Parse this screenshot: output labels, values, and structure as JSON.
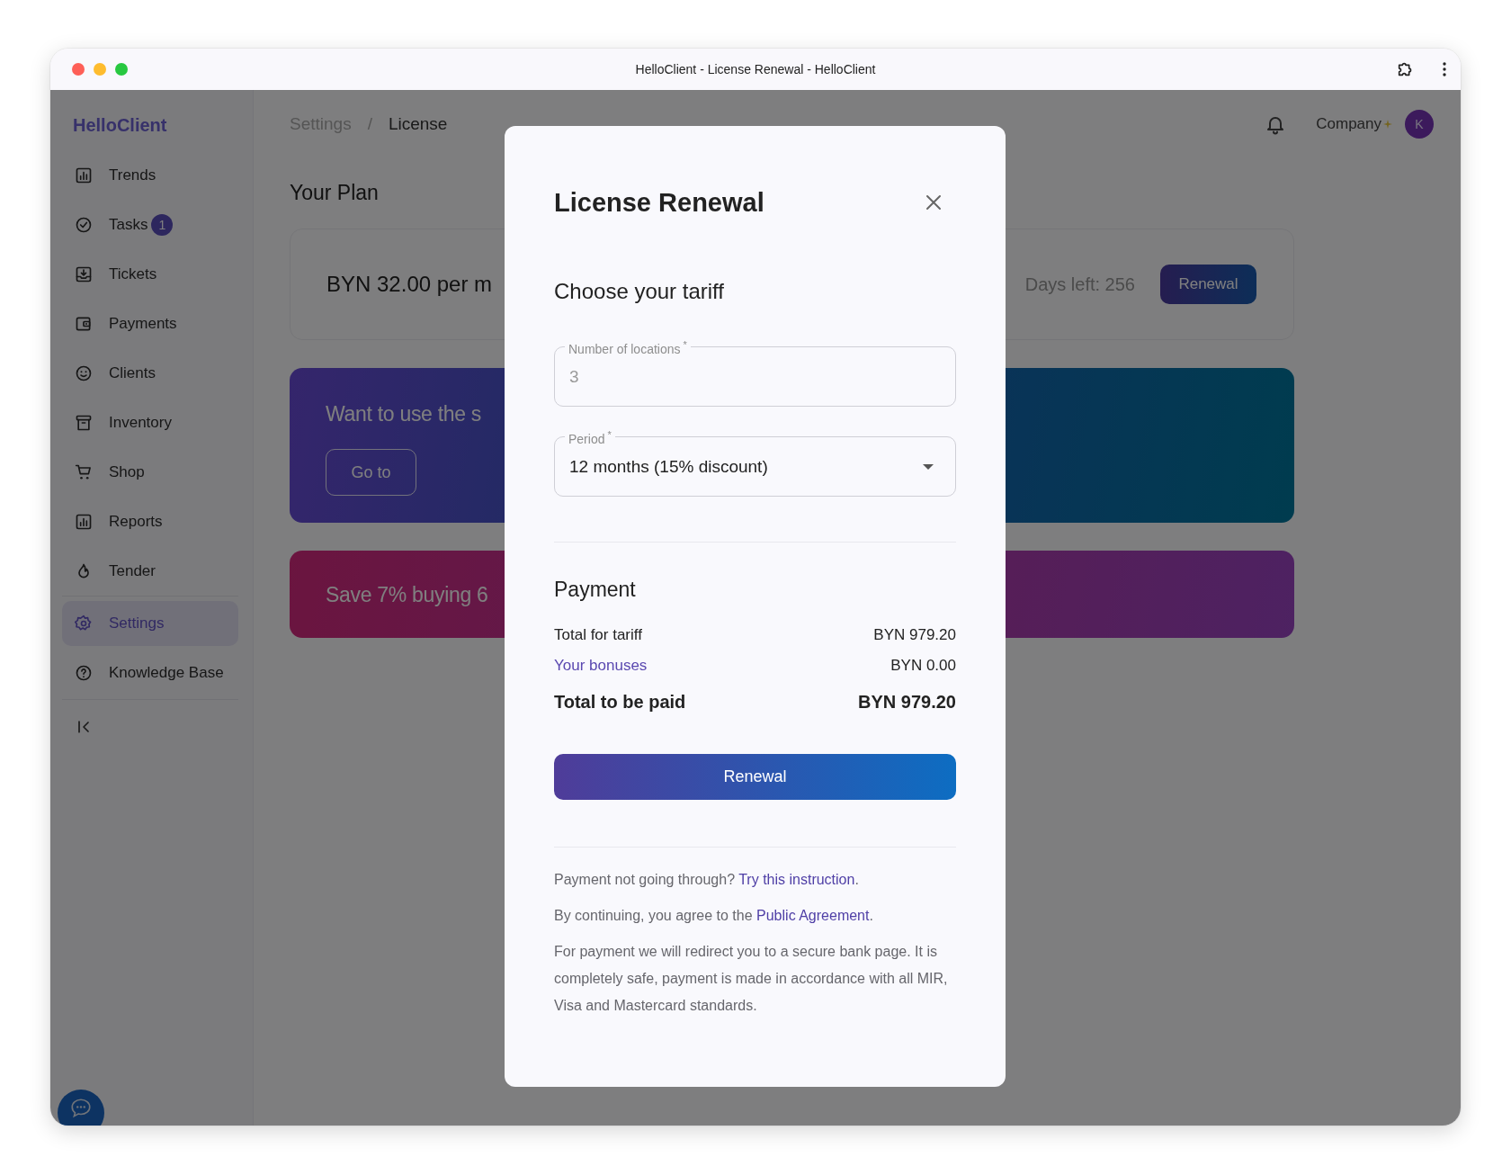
{
  "window": {
    "title": "HelloClient - License Renewal - HelloClient"
  },
  "sidebar": {
    "logo": "HelloClient",
    "items": [
      {
        "label": "Trends",
        "selected": false
      },
      {
        "label": "Tasks",
        "badge": "1",
        "selected": false
      },
      {
        "label": "Tickets",
        "selected": false
      },
      {
        "label": "Payments",
        "selected": false
      },
      {
        "label": "Clients",
        "selected": false
      },
      {
        "label": "Inventory",
        "selected": false
      },
      {
        "label": "Shop",
        "selected": false
      },
      {
        "label": "Reports",
        "selected": false
      },
      {
        "label": "Tender",
        "selected": false
      }
    ],
    "secondary_items": [
      {
        "label": "Settings",
        "selected": true
      },
      {
        "label": "Knowledge Base",
        "selected": false
      }
    ]
  },
  "header": {
    "breadcrumb": [
      "Settings",
      "License"
    ],
    "separator": "/",
    "company": "Company",
    "avatar": "K"
  },
  "plan": {
    "title": "Your Plan",
    "price": "BYN 32.00 per m",
    "days_left": "Days left: 256",
    "button": "Renewal"
  },
  "promos": [
    {
      "text": "Want to use the s",
      "button": "Go to"
    },
    {
      "text": "Save 7% buying 6"
    }
  ],
  "modal": {
    "title": "License Renewal",
    "section": "Choose your tariff",
    "fields": [
      {
        "kind": "input",
        "label": "Number of locations",
        "mark": "*",
        "placeholder": "3"
      },
      {
        "kind": "select",
        "label": "Period",
        "mark": "*",
        "value": "12 months (15% discount)"
      }
    ],
    "payment": {
      "title": "Payment",
      "rows": [
        {
          "kind": "plain",
          "label": "Total for tariff",
          "value": "BYN 979.20"
        },
        {
          "kind": "link",
          "label": "Your bonuses",
          "value": "BYN 0.00"
        },
        {
          "kind": "total",
          "label": "Total to be paid",
          "value": "BYN 979.20"
        }
      ]
    },
    "button": "Renewal",
    "notes": [
      {
        "text": "Payment not going through?",
        "link": "Try this instruction",
        "suffix": "."
      },
      {
        "text": "By continuing, you agree to the",
        "link": "Public Agreement",
        "suffix": "."
      },
      {
        "text": "For payment we will redirect you to a secure bank page. It is completely safe, payment is made in accordance with all MIR, Visa and Mastercard standards."
      }
    ]
  }
}
